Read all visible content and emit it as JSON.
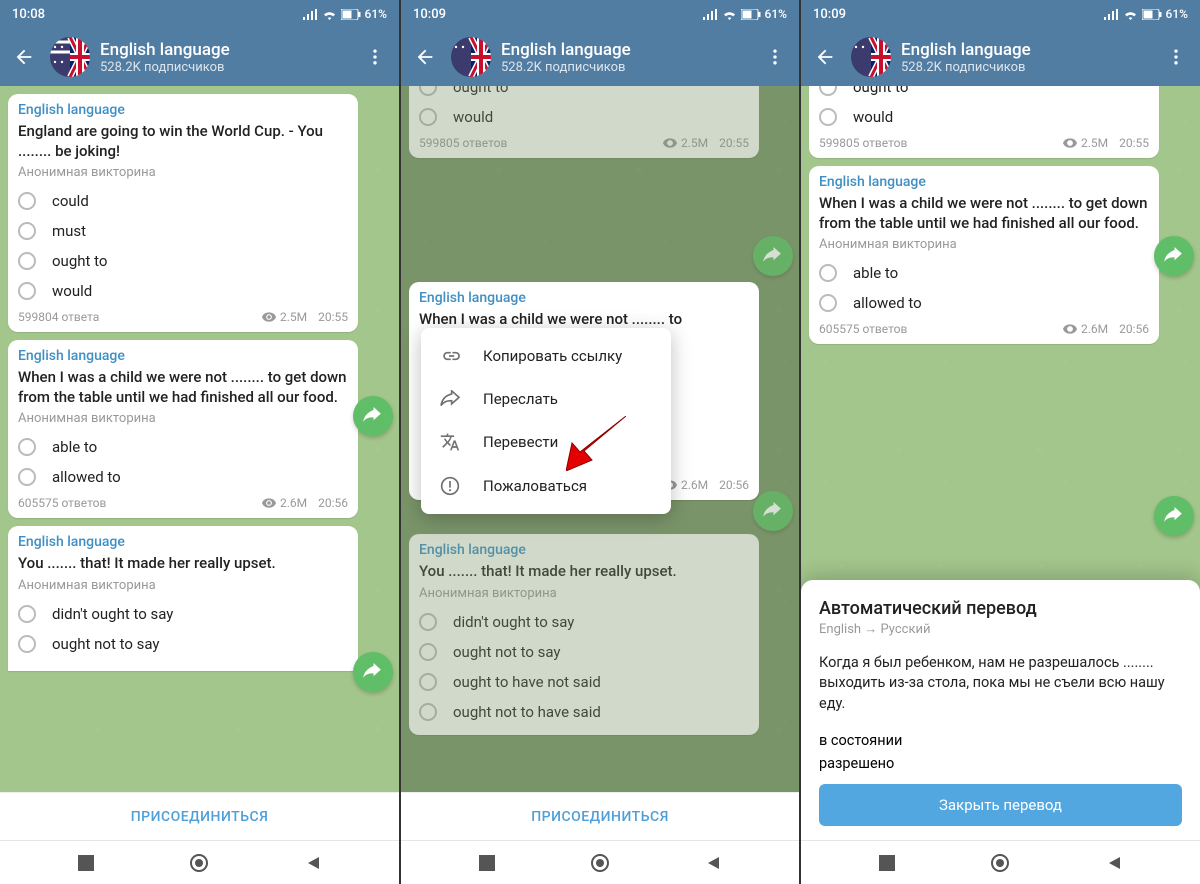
{
  "status": {
    "time1": "10:08",
    "time2": "10:09",
    "time3": "10:09",
    "battery": "61%"
  },
  "header": {
    "title": "English language",
    "subtitle": "528.2K подписчиков"
  },
  "quiz1": {
    "sender": "English language",
    "question": "England are going to win the World Cup. - You ........ be joking!",
    "label": "Анонимная викторина",
    "opts": [
      "could",
      "must",
      "ought to",
      "would"
    ],
    "answers1": "599804 ответа",
    "answers2": "599805 ответов",
    "views": "2.5M",
    "time": "20:55"
  },
  "quiz2": {
    "sender": "English language",
    "question": "When I was a child we were not ........ to get down from the table until we had finished all our food.",
    "label": "Анонимная викторина",
    "opts": [
      "able to",
      "allowed to"
    ],
    "answers": "605575 ответов",
    "views": "2.6M",
    "time": "20:56"
  },
  "quiz3": {
    "sender": "English language",
    "question": "You ....... that! It made her really upset.",
    "label": "Анонимная викторина",
    "opts": [
      "didn't ought to say",
      "ought not to say",
      "ought to have not said",
      "ought not to have said"
    ]
  },
  "join": "ПРИСОЕДИНИТЬСЯ",
  "ctx": {
    "copy": "Копировать ссылку",
    "forward": "Переслать",
    "translate": "Перевести",
    "report": "Пожаловаться"
  },
  "trans": {
    "title": "Автоматический перевод",
    "sub": "English → Русский",
    "body": "Когда я был ребенком, нам не разрешалось ........ выходить из-за стола, пока мы не съели всю нашу еду.",
    "opt1": "в состоянии",
    "opt2": "разрешено",
    "close": "Закрыть перевод"
  },
  "quiz2_short": "When I was a child we were not ........ to"
}
